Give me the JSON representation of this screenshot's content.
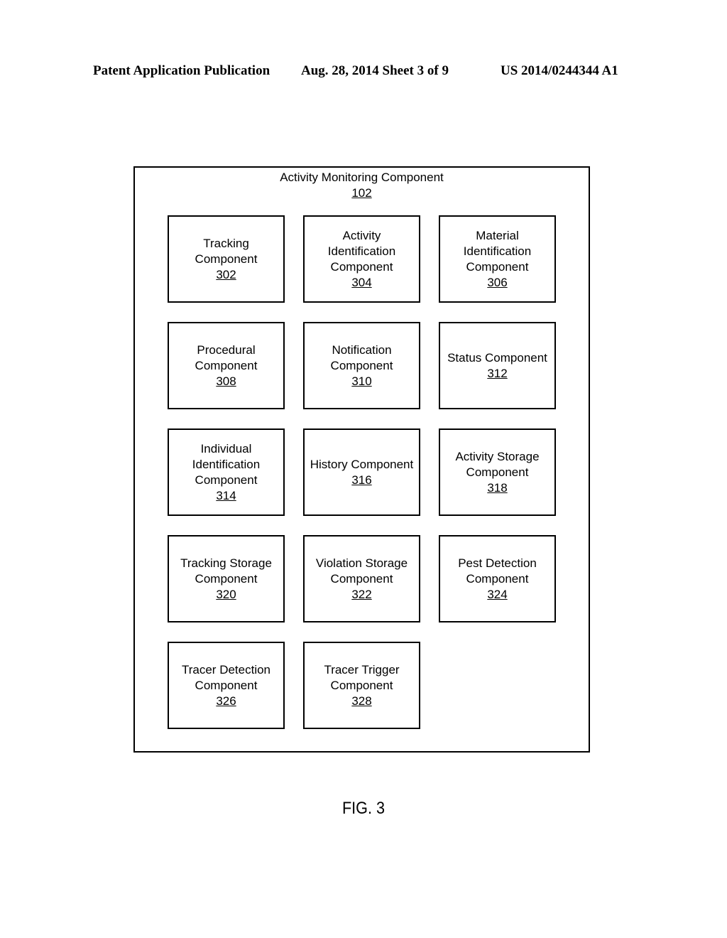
{
  "header": {
    "left": "Patent Application Publication",
    "middle": "Aug. 28, 2014  Sheet 3 of 9",
    "right": "US 2014/0244344 A1"
  },
  "diagram": {
    "title": "Activity Monitoring Component",
    "number": "102",
    "components": [
      {
        "lines": [
          "Tracking",
          "Component"
        ],
        "number": "302"
      },
      {
        "lines": [
          "Activity",
          "Identification",
          "Component"
        ],
        "number": "304"
      },
      {
        "lines": [
          "Material",
          "Identification",
          "Component"
        ],
        "number": "306"
      },
      {
        "lines": [
          "Procedural",
          "Component"
        ],
        "number": "308"
      },
      {
        "lines": [
          "Notification",
          "Component"
        ],
        "number": "310"
      },
      {
        "lines": [
          "Status Component"
        ],
        "number": "312"
      },
      {
        "lines": [
          "Individual",
          "Identification",
          "Component"
        ],
        "number": "314"
      },
      {
        "lines": [
          "History Component"
        ],
        "number": "316"
      },
      {
        "lines": [
          "Activity Storage",
          "Component"
        ],
        "number": "318"
      },
      {
        "lines": [
          "Tracking Storage",
          "Component"
        ],
        "number": "320"
      },
      {
        "lines": [
          "Violation Storage",
          "Component"
        ],
        "number": "322"
      },
      {
        "lines": [
          "Pest Detection",
          "Component"
        ],
        "number": "324"
      },
      {
        "lines": [
          "Tracer Detection",
          "Component"
        ],
        "number": "326"
      },
      {
        "lines": [
          "Tracer Trigger",
          "Component"
        ],
        "number": "328"
      }
    ]
  },
  "figure_label": "FIG. 3"
}
